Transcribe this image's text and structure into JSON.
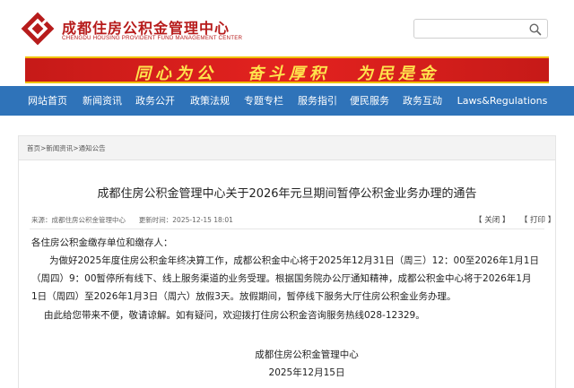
{
  "header": {
    "logo_cn": "成都住房公积金管理中心",
    "logo_en": "CHENGDU HOUSING PROVIDENT FUND MANAGEMENT CENTER",
    "search": {
      "value": "",
      "placeholder": ""
    }
  },
  "banner": {
    "slogans": [
      "同心为公",
      "奋斗厚积",
      "为民是金"
    ]
  },
  "nav": {
    "items": [
      "网站首页",
      "新闻资讯",
      "政务公开",
      "政策法规",
      "专题专栏",
      "服务指引",
      "便民服务",
      "政务互动",
      "Laws&Regulations"
    ]
  },
  "breadcrumb": {
    "items": [
      "首页",
      "新闻资讯",
      "通知公告"
    ],
    "separator": ">"
  },
  "article": {
    "title": "成都住房公积金管理中心关于2026年元旦期间暂停公积金业务办理的通告",
    "source_label": "来源：",
    "source": "成都住房公积金管理中心",
    "date_label": "更新时间：",
    "date": "2025-12-15 18:01",
    "close_label": "【 关闭 】",
    "print_label": "【 打印 】",
    "salutation": "各住房公积金缴存单位和缴存人：",
    "para1_lines": [
      "为做好2025年度住房公积金年终决算工作，成都公积金中心将于2025年12月31日（周三）12：00至2026年1月1日",
      "（周四）9：00暂停所有线下、线上服务渠道的业务受理。根据国务院办公厅通知精神，成都公积金中心将于2026年1月",
      "1日（周四）至2026年1月3日（周六）放假3天。放假期间，暂停线下服务大厅住房公积金业务办理。"
    ],
    "para2": "由此给您带来不便，敬请谅解。如有疑问，欢迎拨打住房公积金咨询服务热线028-12329。",
    "signature_org": "成都住房公积金管理中心",
    "signature_date": "2025年12月15日"
  },
  "colors": {
    "brand_red": "#b71c1c",
    "banner_red": "#d81f1d",
    "slogan_yellow": "#ffe44d",
    "nav_blue": "#2f73b9"
  }
}
